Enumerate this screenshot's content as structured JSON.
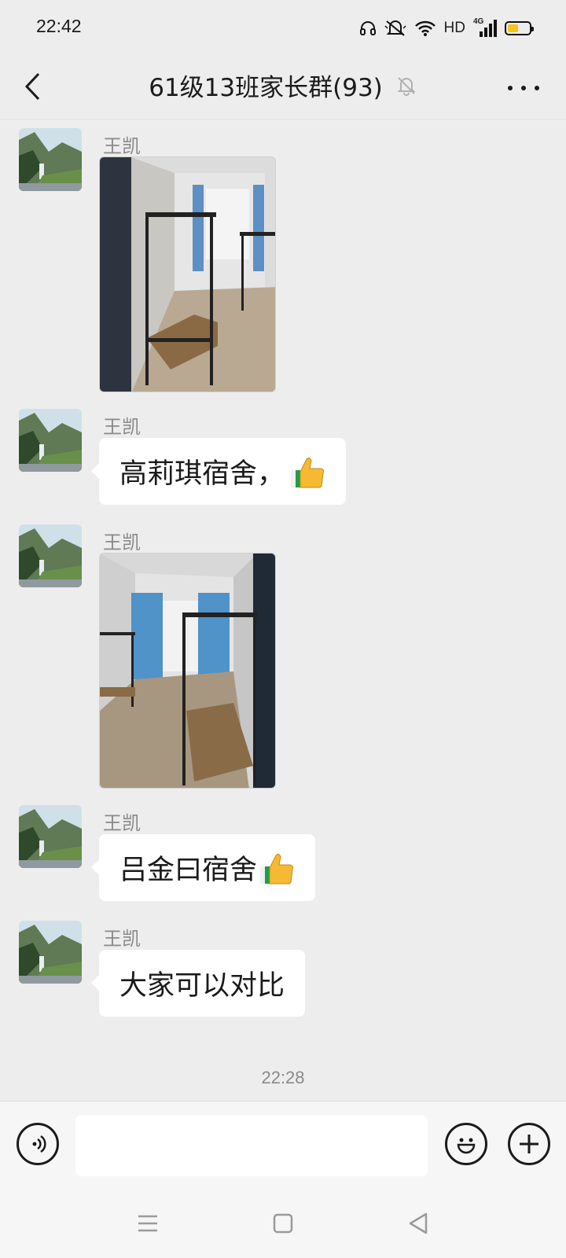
{
  "status_bar": {
    "time": "22:42",
    "hd_label": "HD",
    "network_label": "4G",
    "battery_level": 0.5,
    "icons": [
      "headset-icon",
      "mute-icon",
      "wifi-icon",
      "signal-icon",
      "battery-icon"
    ]
  },
  "header": {
    "title": "61级13班家长群(93)",
    "back_icon": "chevron-left-icon",
    "mute_icon": "bell-off-icon",
    "more_icon": "more-dots-icon"
  },
  "messages": [
    {
      "sender": "王凯",
      "type": "image",
      "image_desc_icon": "dorm-photo-1"
    },
    {
      "sender": "王凯",
      "type": "text",
      "text": "高莉琪宿舍，",
      "emoji": "thumbs-up-icon"
    },
    {
      "sender": "王凯",
      "type": "image",
      "image_desc_icon": "dorm-photo-2"
    },
    {
      "sender": "王凯",
      "type": "text",
      "text": "吕金曰宿舍",
      "emoji": "thumbs-up-icon"
    },
    {
      "sender": "王凯",
      "type": "text",
      "text": "大家可以对比"
    }
  ],
  "time_separator": "22:28",
  "input_bar": {
    "voice_icon": "voice-icon",
    "input_value": "",
    "emoji_icon": "smiley-icon",
    "plus_icon": "plus-icon"
  },
  "nav_bar": {
    "icons": [
      "menu-icon",
      "home-square-icon",
      "back-triangle-icon"
    ]
  },
  "colors": {
    "background": "#ededed",
    "bubble": "#ffffff",
    "sender_text": "#8a8a8a",
    "battery": "#f5c518"
  }
}
